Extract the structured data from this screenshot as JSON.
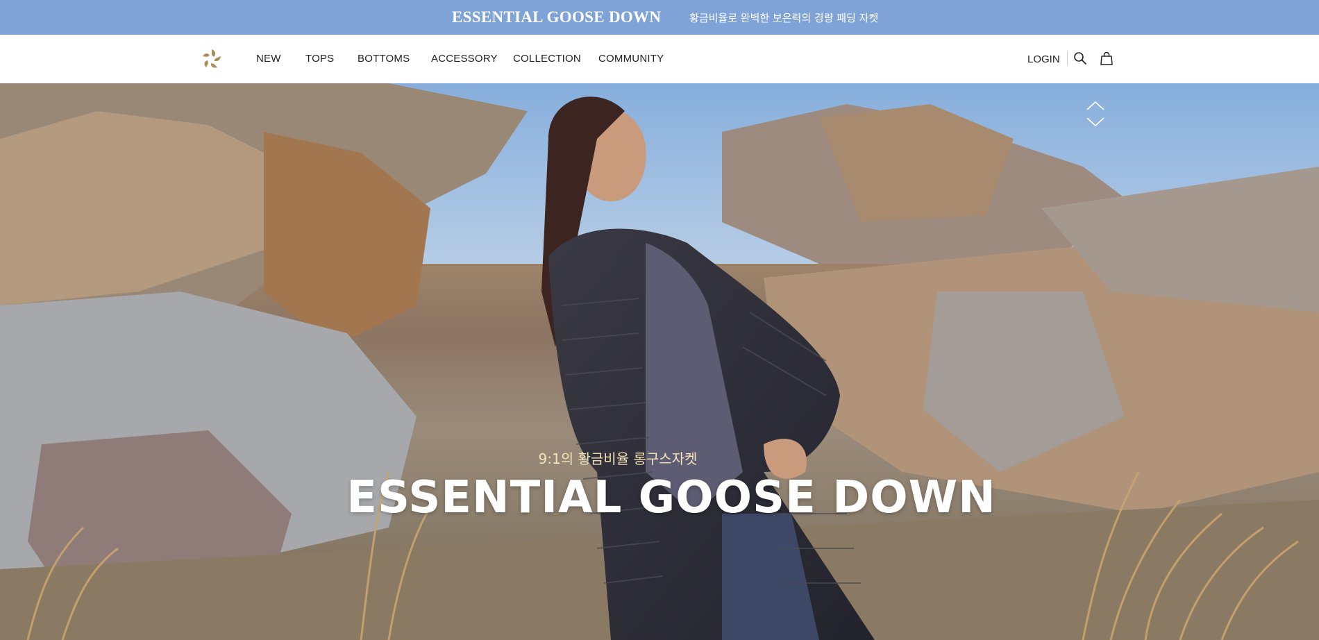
{
  "banner": {
    "brand": "ESSENTIAL GOOSE DOWN",
    "tagline": "황금비율로 완벽한 보온력의 경량 패딩 자켓",
    "background": "#7fa3d6"
  },
  "nav": {
    "logo_icon": "brand-logo-icon",
    "menu": [
      {
        "label": "NEW"
      },
      {
        "label": "TOPS"
      },
      {
        "label": "BOTTOMS"
      },
      {
        "label": "ACCESSORY"
      },
      {
        "label": "COLLECTION"
      },
      {
        "label": "COMMUNITY"
      }
    ],
    "login_label": "LOGIN",
    "search_icon": "search-icon",
    "cart_icon": "shopping-bag-icon"
  },
  "hero": {
    "subtitle": "9:1의 황금비율 롱구스자켓",
    "title": "ESSENTIAL GOOSE DOWN",
    "prev_icon": "chevron-up-icon",
    "next_icon": "chevron-down-icon"
  }
}
